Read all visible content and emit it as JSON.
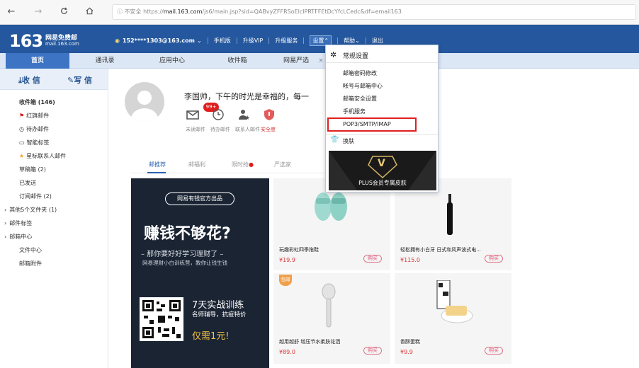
{
  "browser": {
    "url_prefix": "不安全",
    "url_scheme": "https://",
    "url_host": "mail.163.com",
    "url_path": "/js6/main.jsp?sid=QABvyZFFRSoElclPRTFFEtDcYfcLCedc&df=email163",
    "icons": [
      "back-arrow-icon",
      "forward-arrow-icon",
      "refresh-icon",
      "home-icon",
      "info-icon"
    ]
  },
  "header": {
    "logo_number": "163",
    "logo_line1": "网易免费邮",
    "logo_line2": "mail.163.com",
    "account": "152****1303@163.com",
    "menu": [
      "手机版",
      "升级VIP",
      "升级服务",
      "设置",
      "帮助",
      "退出"
    ]
  },
  "tabs": [
    "首页",
    "通讯录",
    "应用中心",
    "收件箱",
    "网易严选"
  ],
  "sidebar": {
    "receive": "收 信",
    "write": "写 信",
    "folders": [
      {
        "label": "收件箱 (146)",
        "icon": ""
      },
      {
        "label": "红旗邮件",
        "icon": "flag-icon"
      },
      {
        "label": "待办邮件",
        "icon": "clock-icon"
      },
      {
        "label": "智能标签",
        "icon": "tag-icon"
      },
      {
        "label": "星标联系人邮件",
        "icon": "star-icon"
      },
      {
        "label": "草稿箱 (2)",
        "icon": ""
      },
      {
        "label": "已发送",
        "icon": ""
      },
      {
        "label": "订阅邮件 (2)",
        "icon": ""
      },
      {
        "label": "其他5个文件夹 (1)",
        "icon": "chevron-right-icon"
      },
      {
        "label": "邮件标签",
        "icon": "chevron-right-icon"
      },
      {
        "label": "邮箱中心",
        "icon": "chevron-right-icon"
      },
      {
        "label": "文件中心",
        "icon": ""
      },
      {
        "label": "邮箱附件",
        "icon": ""
      }
    ]
  },
  "home": {
    "greeting": "李国帅，下午的时光是幸福的，每一",
    "badge": "99+",
    "quick": [
      "未读邮件",
      "待办邮件",
      "联系人邮件",
      "安全度"
    ],
    "subtabs": [
      "邮推荐",
      "邮福利",
      "限时抢",
      "严选家"
    ]
  },
  "ad": {
    "brand": "网易有钱官方出品",
    "headline": "赚钱不够花?",
    "line1": "– 那你要好好学习理财了 –",
    "line2": "网易理财小白训练营，教你让钱生钱",
    "promo_title": "7天实战训练",
    "promo_sub": "名师辅导，抗疫特价",
    "promo_price": "仅需1元!"
  },
  "products": [
    {
      "name": "玩趣彩虹四季拖鞋",
      "price": "¥19.9",
      "buy": "购买",
      "tag": ""
    },
    {
      "name": "轻松拥有小白牙 日式和风声波式电...",
      "price": "¥115.0",
      "buy": "购买",
      "tag": ""
    },
    {
      "name": "越用越舒 增压节水柔肤花洒",
      "price": "¥89.0",
      "buy": "购买",
      "tag": "包邮"
    },
    {
      "name": "香酥蛋糕",
      "price": "¥9.9",
      "buy": "购买",
      "tag": ""
    }
  ],
  "settings_menu": {
    "title": "常规设置",
    "items": [
      "邮箱密码修改",
      "帐号与邮箱中心",
      "邮箱安全设置",
      "手机服务",
      "POP3/SMTP/IMAP"
    ],
    "skin": "换肤",
    "skin_banner": "PLUS会员专属皮肤",
    "skin_letter": "V"
  },
  "colors": {
    "header": "#24579d",
    "highlight": "#e02020",
    "tab_active": "#3d74c4"
  }
}
